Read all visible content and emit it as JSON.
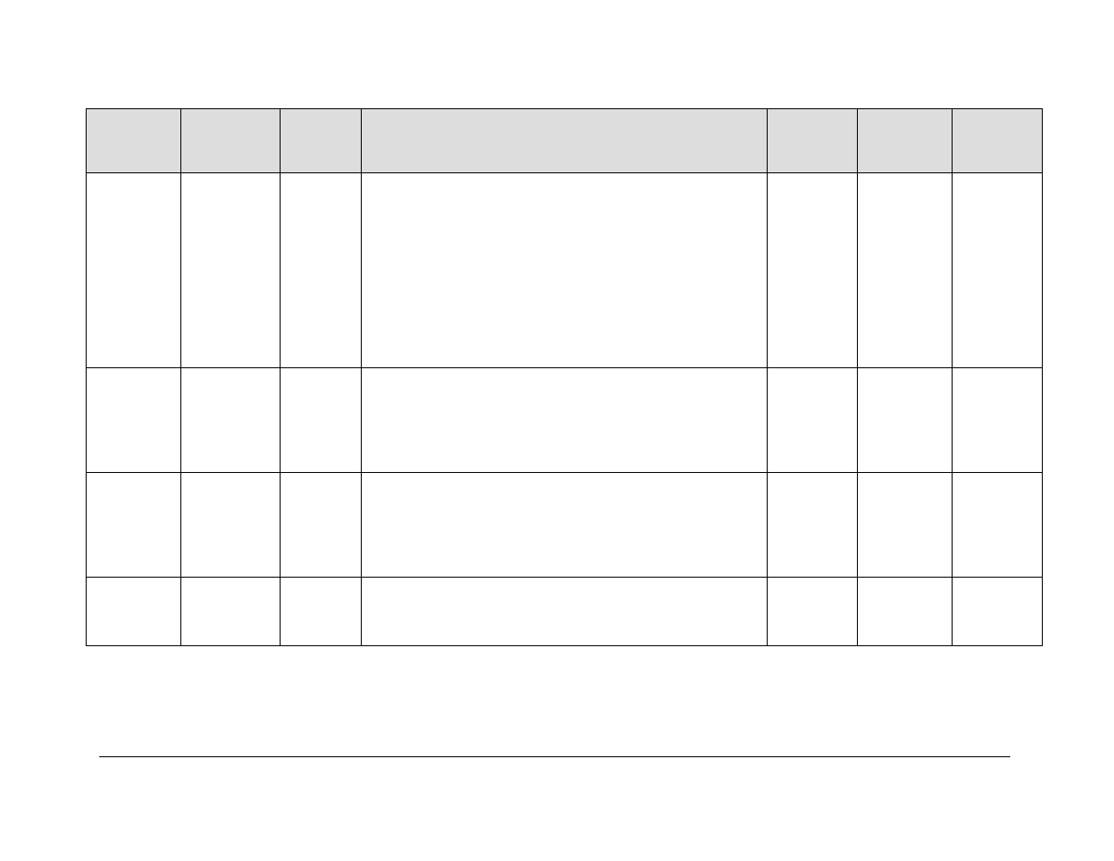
{
  "table": {
    "headers": [
      "",
      "",
      "",
      "",
      "",
      "",
      ""
    ],
    "rows": [
      [
        "",
        "",
        "",
        "",
        "",
        "",
        ""
      ],
      [
        "",
        "",
        "",
        "",
        "",
        "",
        ""
      ],
      [
        "",
        "",
        "",
        "",
        "",
        "",
        ""
      ],
      [
        "",
        "",
        "",
        "",
        "",
        "",
        ""
      ]
    ]
  }
}
